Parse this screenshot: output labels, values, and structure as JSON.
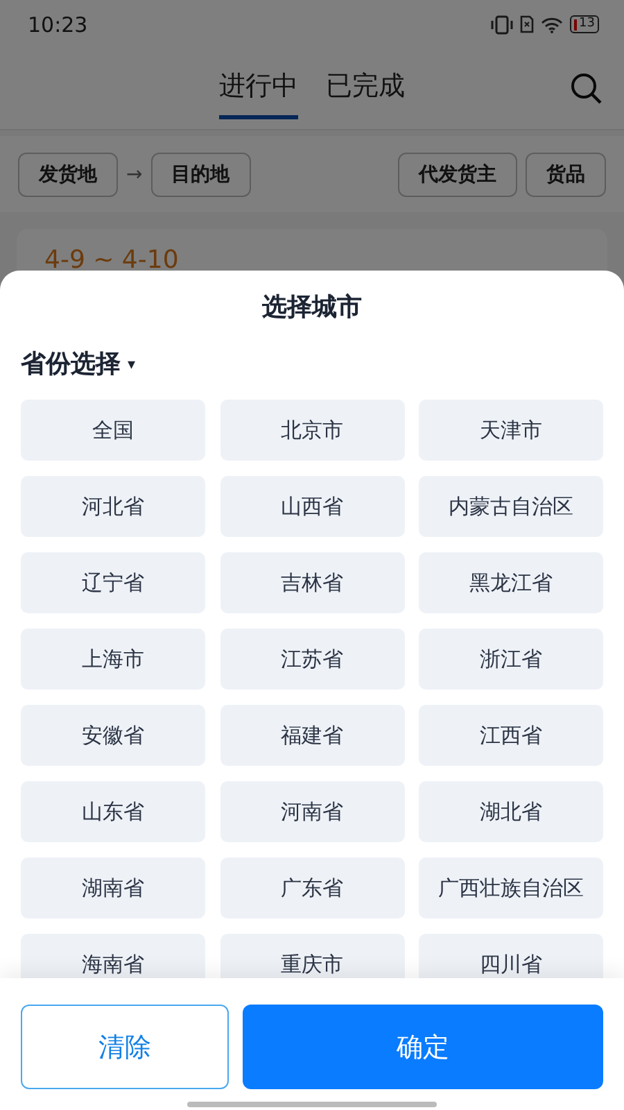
{
  "status_bar": {
    "time": "10:23",
    "battery": "13"
  },
  "tabs": [
    {
      "label": "进行中",
      "selected": true
    },
    {
      "label": "已完成",
      "selected": false
    }
  ],
  "filters": {
    "origin": "发货地",
    "arrow": "→",
    "destination": "目的地",
    "right": [
      "代发货主",
      "货品"
    ]
  },
  "card": {
    "date_range": "4-9 ~ 4-10"
  },
  "sheet": {
    "title": "选择城市",
    "dropdown": "省份选择",
    "dropdown_caret": "▾",
    "cities": [
      "全国",
      "北京市",
      "天津市",
      "河北省",
      "山西省",
      "内蒙古自治区",
      "辽宁省",
      "吉林省",
      "黑龙江省",
      "上海市",
      "江苏省",
      "浙江省",
      "安徽省",
      "福建省",
      "江西省",
      "山东省",
      "河南省",
      "湖北省",
      "湖南省",
      "广东省",
      "广西壮族自治区",
      "海南省",
      "重庆市",
      "四川省"
    ],
    "buttons": [
      {
        "kind": "outline",
        "label": "清除"
      },
      {
        "kind": "primary",
        "label": "确定"
      }
    ]
  }
}
